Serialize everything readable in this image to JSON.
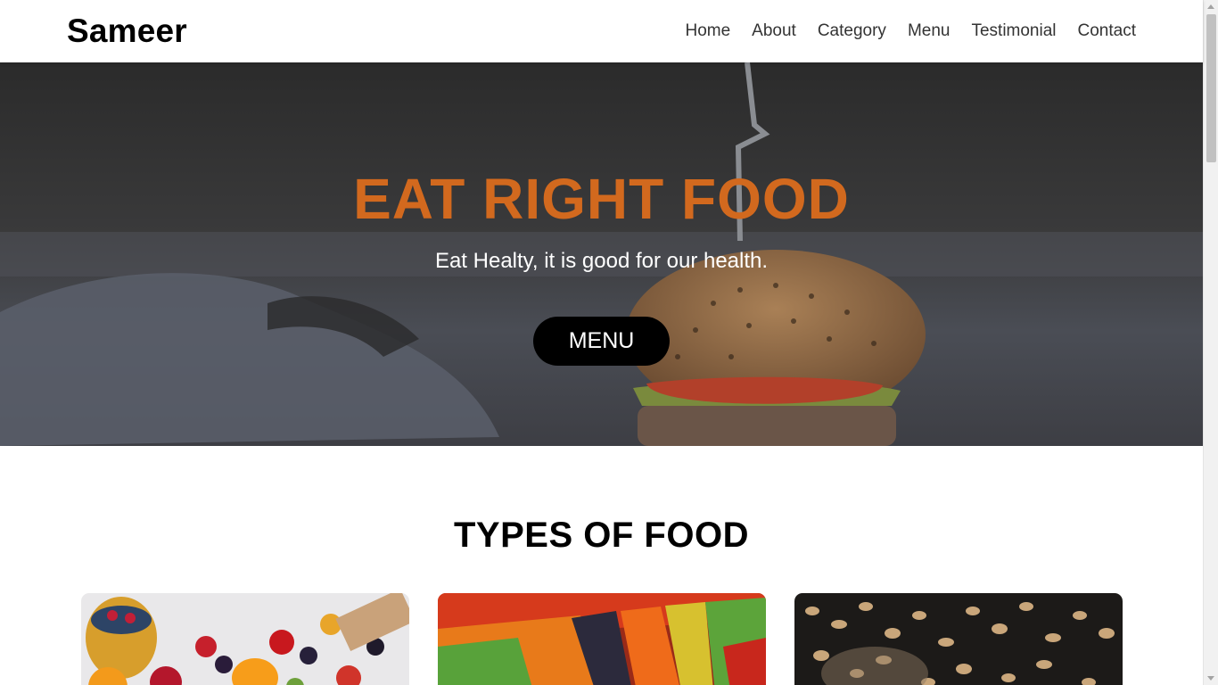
{
  "brand": "Sameer",
  "nav": {
    "links": [
      "Home",
      "About",
      "Category",
      "Menu",
      "Testimonial",
      "Contact"
    ]
  },
  "hero": {
    "title": "EAT RIGHT FOOD",
    "subtitle": "Eat Healty, it is good for our health.",
    "button_label": "MENU",
    "title_color": "#d2691e"
  },
  "section": {
    "title": "TYPES OF FOOD"
  },
  "cards": [
    {
      "image": "fruits-image"
    },
    {
      "image": "vegetables-image"
    },
    {
      "image": "grains-image"
    }
  ]
}
